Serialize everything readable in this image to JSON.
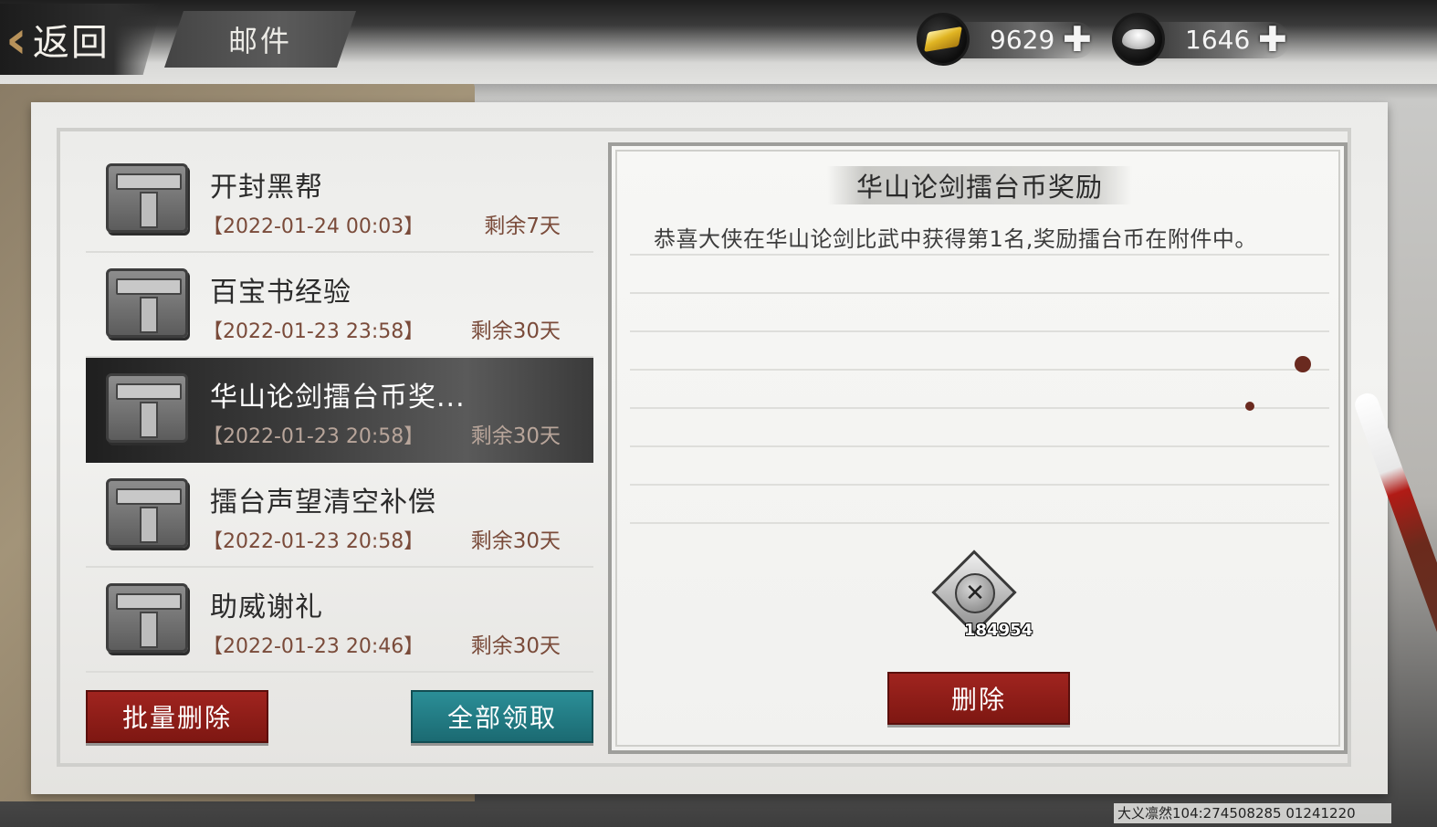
{
  "header": {
    "back_label": "返回",
    "title": "邮件",
    "currencies": [
      {
        "icon": "gold-ingot-icon",
        "amount": "9629"
      },
      {
        "icon": "silver-ingot-icon",
        "amount": "1646"
      }
    ]
  },
  "mail_list": {
    "items": [
      {
        "title": "开封黑帮",
        "date": "【2022-01-24 00:03】",
        "remaining": "剩余7天"
      },
      {
        "title": "百宝书经验",
        "date": "【2022-01-23 23:58】",
        "remaining": "剩余30天"
      },
      {
        "title": "华山论剑擂台币奖...",
        "date": "【2022-01-23 20:58】",
        "remaining": "剩余30天",
        "selected": true
      },
      {
        "title": "擂台声望清空补偿",
        "date": "【2022-01-23 20:58】",
        "remaining": "剩余30天"
      },
      {
        "title": "助威谢礼",
        "date": "【2022-01-23 20:46】",
        "remaining": "剩余30天"
      }
    ],
    "batch_delete_label": "批量删除",
    "claim_all_label": "全部领取"
  },
  "detail": {
    "title": "华山论剑擂台币奖励",
    "body": "恭喜大侠在华山论剑比武中获得第1名,奖励擂台币在附件中。",
    "attachment": {
      "icon": "arena-coin-icon",
      "count": "184954"
    },
    "delete_label": "删除"
  },
  "footer": {
    "watermark": "大义凛然104:274508285 01241220"
  }
}
